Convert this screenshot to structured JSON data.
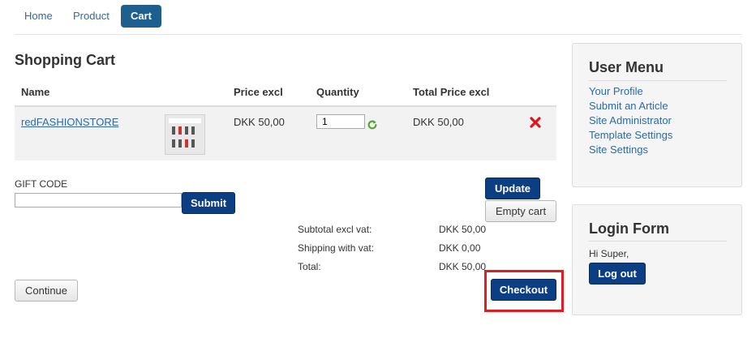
{
  "nav": {
    "home": "Home",
    "product": "Product",
    "cart": "Cart"
  },
  "page_title": "Shopping Cart",
  "table": {
    "headers": {
      "name": "Name",
      "price_excl": "Price excl",
      "quantity": "Quantity",
      "total_price_excl": "Total Price excl"
    },
    "rows": [
      {
        "name": "redFASHIONSTORE",
        "price_excl": "DKK 50,00",
        "quantity": "1",
        "total_price_excl": "DKK 50,00"
      }
    ]
  },
  "gift_code": {
    "label": "GIFT CODE",
    "value": "",
    "submit_label": "Submit"
  },
  "buttons": {
    "update": "Update",
    "empty_cart": "Empty cart",
    "continue": "Continue",
    "checkout": "Checkout"
  },
  "summary": {
    "subtotal_label": "Subtotal excl vat:",
    "subtotal_value": "DKK 50,00",
    "shipping_label": "Shipping with vat:",
    "shipping_value": "DKK 0,00",
    "total_label": "Total:",
    "total_value": "DKK 50,00"
  },
  "user_menu": {
    "title": "User Menu",
    "items": [
      "Your Profile",
      "Submit an Article",
      "Site Administrator",
      "Template Settings",
      "Site Settings"
    ]
  },
  "login_form": {
    "title": "Login Form",
    "greeting": "Hi Super,",
    "logout_label": "Log out"
  },
  "colors": {
    "link": "#2f6aa3",
    "primary_button": "#0c3e83",
    "nav_active": "#1d5f8e",
    "highlight": "#e21c23",
    "refresh_icon": "#4aa82e",
    "delete_icon": "#e3121a"
  },
  "icons": {
    "refresh": "refresh-icon",
    "delete": "delete-icon"
  }
}
